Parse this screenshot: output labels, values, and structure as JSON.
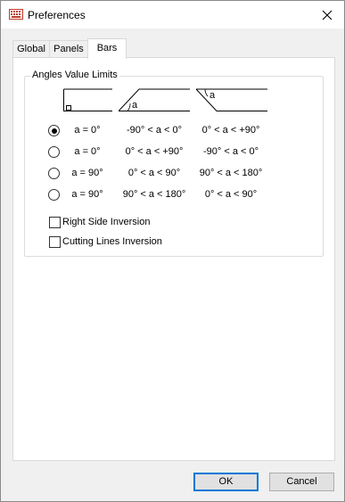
{
  "window": {
    "title": "Preferences",
    "close_icon": "close-icon",
    "app_icon": "keyboard-icon"
  },
  "tabs": [
    {
      "label": "Global"
    },
    {
      "label": "Panels"
    },
    {
      "label": "Bars",
      "active": true
    }
  ],
  "group": {
    "label": "Angles Value Limits"
  },
  "diagrams": {
    "angle_label": "a"
  },
  "rows": [
    {
      "selected": true,
      "cells": [
        "a = 0°",
        "-90° < a < 0°",
        "0° < a < +90°"
      ]
    },
    {
      "selected": false,
      "cells": [
        "a = 0°",
        "0° < a < +90°",
        "-90° < a < 0°"
      ]
    },
    {
      "selected": false,
      "cells": [
        "a = 90°",
        "0° < a < 90°",
        "90° < a < 180°"
      ]
    },
    {
      "selected": false,
      "cells": [
        "a = 90°",
        "90° < a < 180°",
        "0° < a < 90°"
      ]
    }
  ],
  "checkboxes": [
    {
      "label": "Right Side Inversion",
      "checked": false
    },
    {
      "label": "Cutting Lines Inversion",
      "checked": false
    }
  ],
  "buttons": {
    "ok": "OK",
    "cancel": "Cancel"
  },
  "colors": {
    "accent": "#0078d7",
    "panel_border": "#d9d9d9",
    "window_bg": "#f0f0f0"
  }
}
